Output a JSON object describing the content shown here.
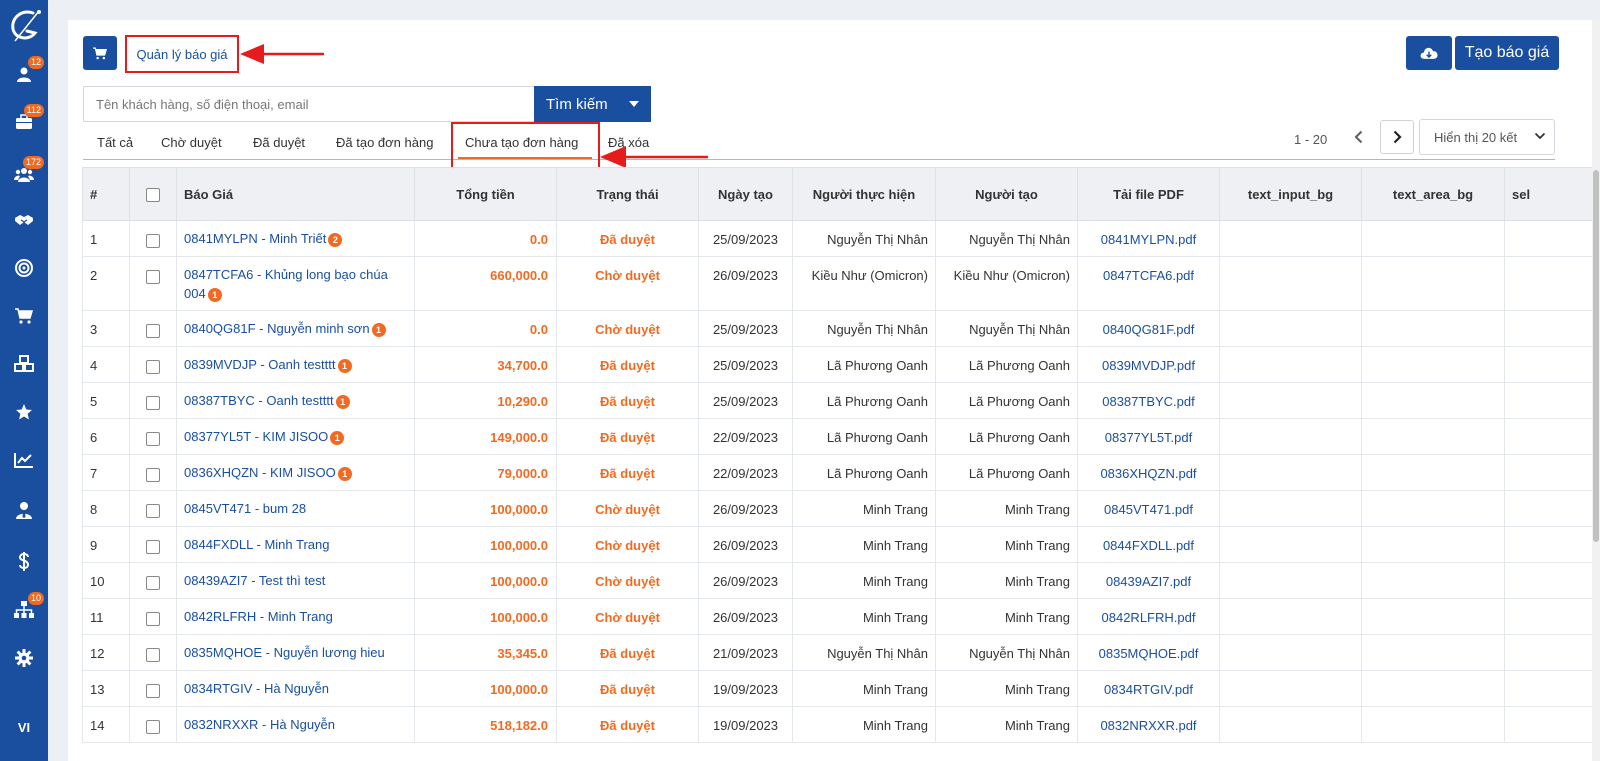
{
  "sidebar": {
    "items": [
      {
        "icon": "user-icon",
        "badge": "12"
      },
      {
        "icon": "briefcase-icon",
        "badge": "112"
      },
      {
        "icon": "users-icon",
        "badge": "172"
      },
      {
        "icon": "handshake-icon",
        "badge": ""
      },
      {
        "icon": "target-icon",
        "badge": ""
      },
      {
        "icon": "cart-icon",
        "badge": ""
      },
      {
        "icon": "cubes-icon",
        "badge": ""
      },
      {
        "icon": "star-icon",
        "badge": ""
      },
      {
        "icon": "chart-line-icon",
        "badge": ""
      },
      {
        "icon": "user-tie-icon",
        "badge": ""
      },
      {
        "icon": "dollar-icon",
        "badge": ""
      },
      {
        "icon": "sitemap-icon",
        "badge": "10"
      },
      {
        "icon": "gear-icon",
        "badge": ""
      }
    ],
    "language": "VI"
  },
  "header": {
    "title": "Quản lý báo giá",
    "create_label": "Tạo báo giá"
  },
  "search": {
    "placeholder": "Tên khách hàng, số điện thoại, email",
    "button_label": "Tìm kiếm"
  },
  "tabs": [
    {
      "label": "Tất cả"
    },
    {
      "label": "Chờ duyệt"
    },
    {
      "label": "Đã duyệt"
    },
    {
      "label": "Đã tạo đơn hàng"
    },
    {
      "label": "Chưa tạo đơn hàng"
    },
    {
      "label": "Đã xóa"
    }
  ],
  "pagination": {
    "range": "1 - 20",
    "page_size_label": "Hiển thị 20 kết"
  },
  "table": {
    "columns": [
      "#",
      "Báo Giá",
      "Tổng tiền",
      "Trạng thái",
      "Ngày tạo",
      "Người thực hiện",
      "Người tạo",
      "Tải file PDF",
      "text_input_bg",
      "text_area_bg",
      "sel"
    ],
    "rows": [
      {
        "num": "1",
        "name": "0841MYLPN - Minh Triết",
        "badge": "2",
        "total": "0.0",
        "status": "Đã duyệt",
        "date": "25/09/2023",
        "executor": "Nguyễn Thị Nhân",
        "creator": "Nguyễn Thị Nhân",
        "pdf": "0841MYLPN.pdf"
      },
      {
        "num": "2",
        "name": "0847TCFA6 - Khủng long bạo chúa 004",
        "badge": "1",
        "total": "660,000.0",
        "status": "Chờ duyệt",
        "date": "26/09/2023",
        "executor": "Kiều Như (Omicron)",
        "creator": "Kiều Như (Omicron)",
        "pdf": "0847TCFA6.pdf"
      },
      {
        "num": "3",
        "name": "0840QG81F - Nguyễn minh sơn",
        "badge": "1",
        "total": "0.0",
        "status": "Chờ duyệt",
        "date": "25/09/2023",
        "executor": "Nguyễn Thị Nhân",
        "creator": "Nguyễn Thị Nhân",
        "pdf": "0840QG81F.pdf"
      },
      {
        "num": "4",
        "name": "0839MVDJP - Oanh testttt",
        "badge": "1",
        "total": "34,700.0",
        "status": "Đã duyệt",
        "date": "25/09/2023",
        "executor": "Lã Phương Oanh",
        "creator": "Lã Phương Oanh",
        "pdf": "0839MVDJP.pdf"
      },
      {
        "num": "5",
        "name": "08387TBYC - Oanh testttt",
        "badge": "1",
        "total": "10,290.0",
        "status": "Đã duyệt",
        "date": "25/09/2023",
        "executor": "Lã Phương Oanh",
        "creator": "Lã Phương Oanh",
        "pdf": "08387TBYC.pdf"
      },
      {
        "num": "6",
        "name": "08377YL5T - KIM JISOO",
        "badge": "1",
        "total": "149,000.0",
        "status": "Đã duyệt",
        "date": "22/09/2023",
        "executor": "Lã Phương Oanh",
        "creator": "Lã Phương Oanh",
        "pdf": "08377YL5T.pdf"
      },
      {
        "num": "7",
        "name": "0836XHQZN - KIM JISOO",
        "badge": "1",
        "total": "79,000.0",
        "status": "Đã duyệt",
        "date": "22/09/2023",
        "executor": "Lã Phương Oanh",
        "creator": "Lã Phương Oanh",
        "pdf": "0836XHQZN.pdf"
      },
      {
        "num": "8",
        "name": "0845VT471 - bum 28",
        "badge": "",
        "total": "100,000.0",
        "status": "Chờ duyệt",
        "date": "26/09/2023",
        "executor": "Minh Trang",
        "creator": "Minh Trang",
        "pdf": "0845VT471.pdf"
      },
      {
        "num": "9",
        "name": "0844FXDLL - Minh Trang",
        "badge": "",
        "total": "100,000.0",
        "status": "Chờ duyệt",
        "date": "26/09/2023",
        "executor": "Minh Trang",
        "creator": "Minh Trang",
        "pdf": "0844FXDLL.pdf"
      },
      {
        "num": "10",
        "name": "08439AZI7 - Test thì test",
        "badge": "",
        "total": "100,000.0",
        "status": "Chờ duyệt",
        "date": "26/09/2023",
        "executor": "Minh Trang",
        "creator": "Minh Trang",
        "pdf": "08439AZI7.pdf"
      },
      {
        "num": "11",
        "name": "0842RLFRH - Minh Trang",
        "badge": "",
        "total": "100,000.0",
        "status": "Chờ duyệt",
        "date": "26/09/2023",
        "executor": "Minh Trang",
        "creator": "Minh Trang",
        "pdf": "0842RLFRH.pdf"
      },
      {
        "num": "12",
        "name": "0835MQHOE - Nguyễn lương hieu",
        "badge": "",
        "total": "35,345.0",
        "status": "Đã duyệt",
        "date": "21/09/2023",
        "executor": "Nguyễn Thị Nhân",
        "creator": "Nguyễn Thị Nhân",
        "pdf": "0835MQHOE.pdf"
      },
      {
        "num": "13",
        "name": "0834RTGIV - Hà Nguyễn",
        "badge": "",
        "total": "100,000.0",
        "status": "Đã duyệt",
        "date": "19/09/2023",
        "executor": "Minh Trang",
        "creator": "Minh Trang",
        "pdf": "0834RTGIV.pdf"
      },
      {
        "num": "14",
        "name": "0832NRXXR - Hà Nguyễn",
        "badge": "",
        "total": "518,182.0",
        "status": "Đã duyệt",
        "date": "19/09/2023",
        "executor": "Minh Trang",
        "creator": "Minh Trang",
        "pdf": "0832NRXXR.pdf"
      }
    ]
  },
  "colors": {
    "primary": "#1a4fa0",
    "accent": "#f26a21",
    "highlight": "#e61b1b"
  }
}
